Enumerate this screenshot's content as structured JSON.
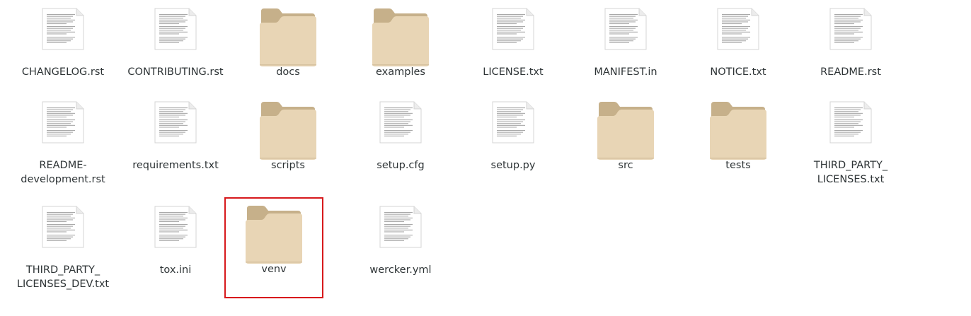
{
  "files": [
    {
      "name": "CHANGELOG.rst",
      "type": "document"
    },
    {
      "name": "CONTRIBUTING.rst",
      "type": "document"
    },
    {
      "name": "docs",
      "type": "folder"
    },
    {
      "name": "examples",
      "type": "folder"
    },
    {
      "name": "LICENSE.txt",
      "type": "document"
    },
    {
      "name": "MANIFEST.in",
      "type": "document"
    },
    {
      "name": "NOTICE.txt",
      "type": "document"
    },
    {
      "name": "README.rst",
      "type": "document"
    },
    {
      "name": "README-\ndevelopment.rst",
      "type": "document"
    },
    {
      "name": "requirements.txt",
      "type": "document"
    },
    {
      "name": "scripts",
      "type": "folder"
    },
    {
      "name": "setup.cfg",
      "type": "document"
    },
    {
      "name": "setup.py",
      "type": "document"
    },
    {
      "name": "src",
      "type": "folder"
    },
    {
      "name": "tests",
      "type": "folder"
    },
    {
      "name": "THIRD_PARTY_\nLICENSES.txt",
      "type": "document"
    },
    {
      "name": "THIRD_PARTY_\nLICENSES_DEV.txt",
      "type": "document"
    },
    {
      "name": "tox.ini",
      "type": "document"
    },
    {
      "name": "venv",
      "type": "folder",
      "selected": true
    },
    {
      "name": "wercker.yml",
      "type": "document"
    }
  ],
  "icons": {
    "folder": "folder-icon",
    "document": "text-document-icon"
  },
  "colors": {
    "folder_back": "#c6b08a",
    "folder_front": "#e8d5b5",
    "selection_border": "#d7191c",
    "label_text": "#2e3436"
  }
}
